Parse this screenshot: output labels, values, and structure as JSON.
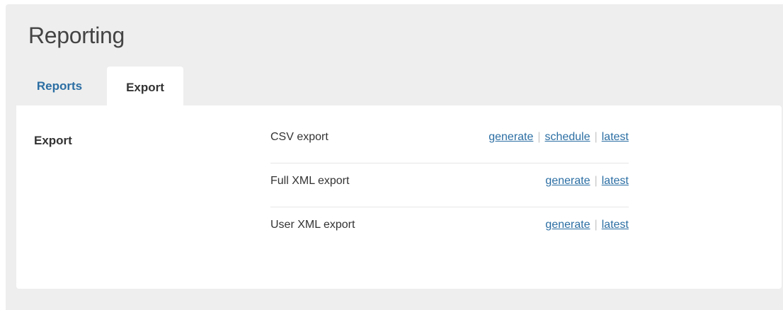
{
  "page": {
    "title": "Reporting"
  },
  "tabs": [
    {
      "label": "Reports",
      "active": false
    },
    {
      "label": "Export",
      "active": true
    }
  ],
  "export_section": {
    "label": "Export",
    "rows": [
      {
        "label": "CSV export",
        "actions": [
          "generate",
          "schedule",
          "latest"
        ]
      },
      {
        "label": "Full XML export",
        "actions": [
          "generate",
          "latest"
        ]
      },
      {
        "label": "User XML export",
        "actions": [
          "generate",
          "latest"
        ]
      }
    ],
    "separator": "|"
  },
  "colors": {
    "link": "#2b6ea3",
    "background": "#eeeeee",
    "panel": "#ffffff",
    "text": "#333333"
  }
}
